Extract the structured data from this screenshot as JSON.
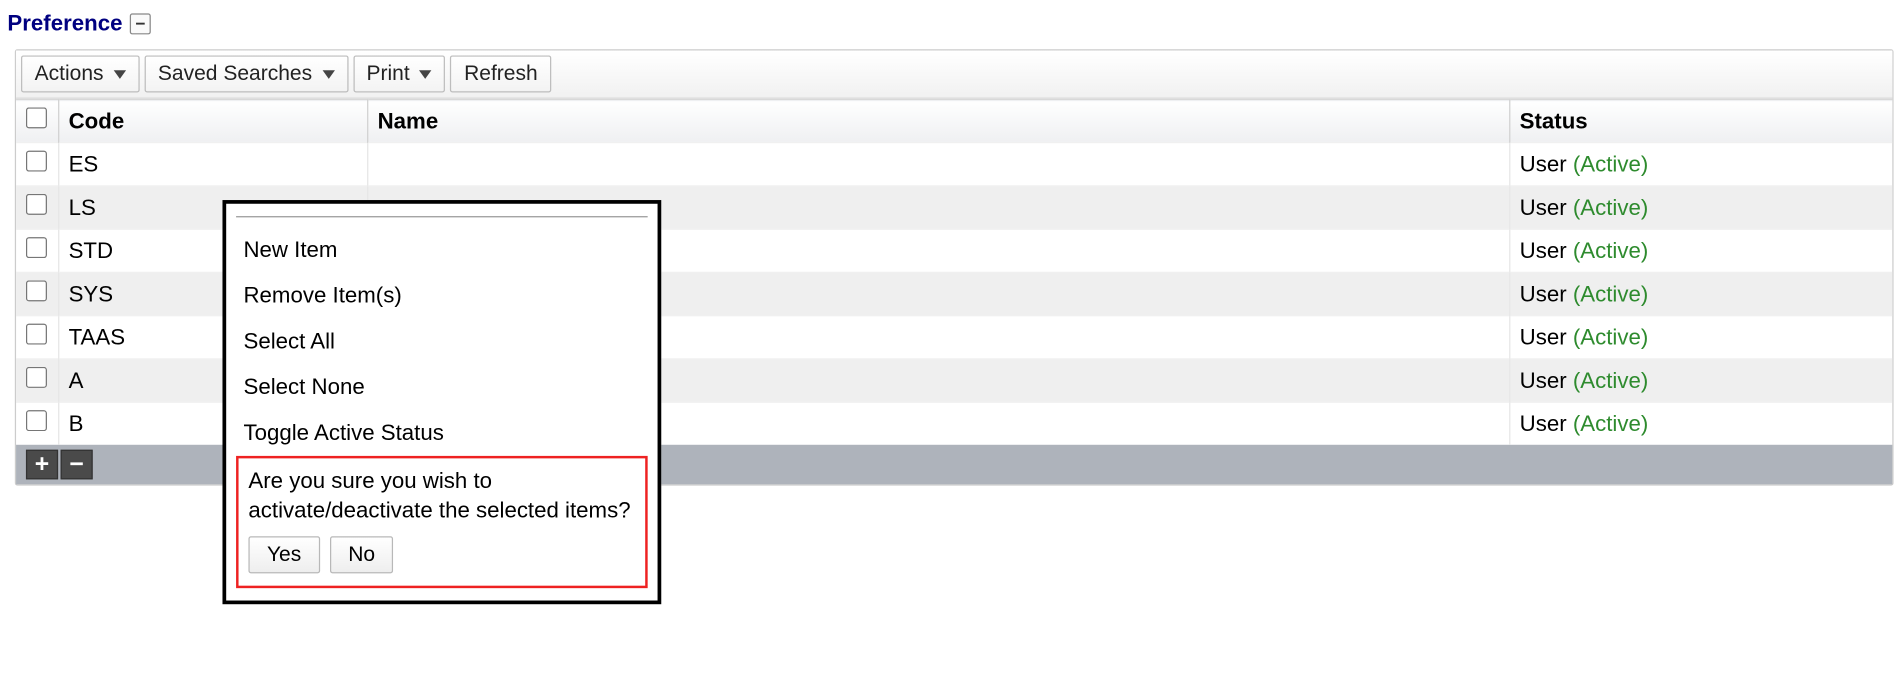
{
  "panel": {
    "title": "Preference"
  },
  "toolbar": {
    "actions_label": "Actions",
    "saved_searches_label": "Saved Searches",
    "print_label": "Print",
    "refresh_label": "Refresh"
  },
  "table": {
    "headers": {
      "code": "Code",
      "name": "Name",
      "status": "Status"
    },
    "rows": [
      {
        "code": "ES",
        "name": "",
        "status_user": "User",
        "status_state": "(Active)"
      },
      {
        "code": "LS",
        "name": "",
        "status_user": "User",
        "status_state": "(Active)"
      },
      {
        "code": "STD",
        "name": "",
        "status_user": "User",
        "status_state": "(Active)"
      },
      {
        "code": "SYS",
        "name": "",
        "status_user": "User",
        "status_state": "(Active)"
      },
      {
        "code": "TAAS",
        "name": "",
        "status_user": "User",
        "status_state": "(Active)"
      },
      {
        "code": "A",
        "name": "",
        "status_user": "User",
        "status_state": "(Active)"
      },
      {
        "code": "B",
        "name": "",
        "status_user": "User",
        "status_state": "(Active)"
      }
    ]
  },
  "popup": {
    "items": [
      "New Item",
      "Remove Item(s)",
      "Select All",
      "Select None",
      "Toggle Active Status"
    ],
    "confirm_msg": "Are you sure you wish to activate/deactivate the selected items?",
    "yes_label": "Yes",
    "no_label": "No"
  }
}
